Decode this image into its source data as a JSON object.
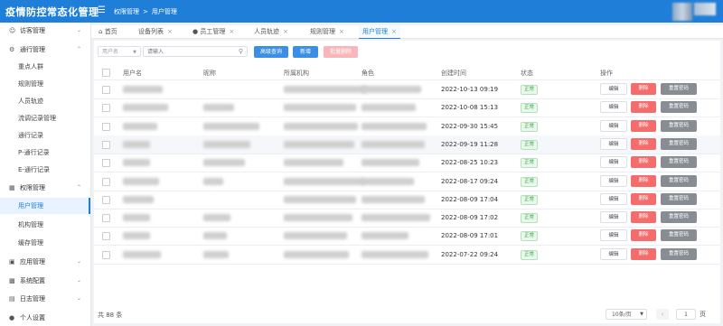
{
  "app": {
    "title": "疫情防控常态化管理"
  },
  "breadcrumb": [
    "权限管理",
    "用户管理"
  ],
  "sidebar": {
    "items": [
      {
        "label": "访客管理",
        "icon": "user-icon",
        "kind": "group",
        "open": false
      },
      {
        "label": "通行管理",
        "icon": "gear-icon",
        "kind": "group",
        "open": true
      },
      {
        "label": "重点人群",
        "kind": "sub"
      },
      {
        "label": "规则管理",
        "kind": "sub"
      },
      {
        "label": "人员轨迹",
        "kind": "sub"
      },
      {
        "label": "流调记录管理",
        "kind": "sub"
      },
      {
        "label": "通行记录",
        "kind": "sub"
      },
      {
        "label": "P-通行记录",
        "kind": "sub"
      },
      {
        "label": "E-通行记录",
        "kind": "sub"
      },
      {
        "label": "权限管理",
        "icon": "grid-icon",
        "kind": "group",
        "open": true
      },
      {
        "label": "用户管理",
        "kind": "sub",
        "active": true
      },
      {
        "label": "机构管理",
        "kind": "sub"
      },
      {
        "label": "缓存管理",
        "kind": "sub"
      },
      {
        "label": "应用管理",
        "icon": "apps-icon",
        "kind": "group",
        "open": false
      },
      {
        "label": "系统配置",
        "icon": "monitor-icon",
        "kind": "group",
        "open": false
      },
      {
        "label": "日志管理",
        "icon": "log-icon",
        "kind": "group",
        "open": false
      },
      {
        "label": "个人设置",
        "icon": "person-icon",
        "kind": "group",
        "open": false
      }
    ]
  },
  "tabs": [
    {
      "label": "首页",
      "icon": "home-icon",
      "closable": false
    },
    {
      "label": "设备列表",
      "closable": true
    },
    {
      "label": "员工管理",
      "icon": "person-icon",
      "closable": true
    },
    {
      "label": "人员轨迹",
      "closable": true
    },
    {
      "label": "规则管理",
      "closable": true
    },
    {
      "label": "用户管理",
      "closable": true,
      "active": true
    }
  ],
  "toolbar": {
    "filter_select": "用户名",
    "search_placeholder": "请输入",
    "advanced_search": "高级查询",
    "add": "新增",
    "batch_delete": "批量删除"
  },
  "table": {
    "columns": [
      "用户名",
      "昵称",
      "所属机构",
      "角色",
      "创建时间",
      "状态",
      "操作"
    ],
    "rows": [
      {
        "created": "2022-10-13 09:19",
        "status": "正常"
      },
      {
        "created": "2022-10-08 15:13",
        "status": "正常"
      },
      {
        "created": "2022-09-30 15:45",
        "status": "正常"
      },
      {
        "created": "2022-09-19 11:28",
        "status": "正常"
      },
      {
        "created": "2022-08-25 10:23",
        "status": "正常"
      },
      {
        "created": "2022-08-17 09:24",
        "status": "正常"
      },
      {
        "created": "2022-08-09 17:04",
        "status": "正常"
      },
      {
        "created": "2022-08-09 17:02",
        "status": "正常"
      },
      {
        "created": "2022-08-09 17:01",
        "status": "正常"
      },
      {
        "created": "2022-07-22 09:24",
        "status": "正常"
      }
    ],
    "actions": {
      "edit": "编辑",
      "delete": "删除",
      "reset_password": "重置密码"
    }
  },
  "pagination": {
    "total": "共 88 条",
    "page_size": "10条/页",
    "current": "1",
    "total_pages": "页"
  },
  "colors": {
    "primary": "#1f7fd8",
    "danger": "#f56c6c",
    "success": "#3aa845",
    "neutral": "#888d94"
  }
}
